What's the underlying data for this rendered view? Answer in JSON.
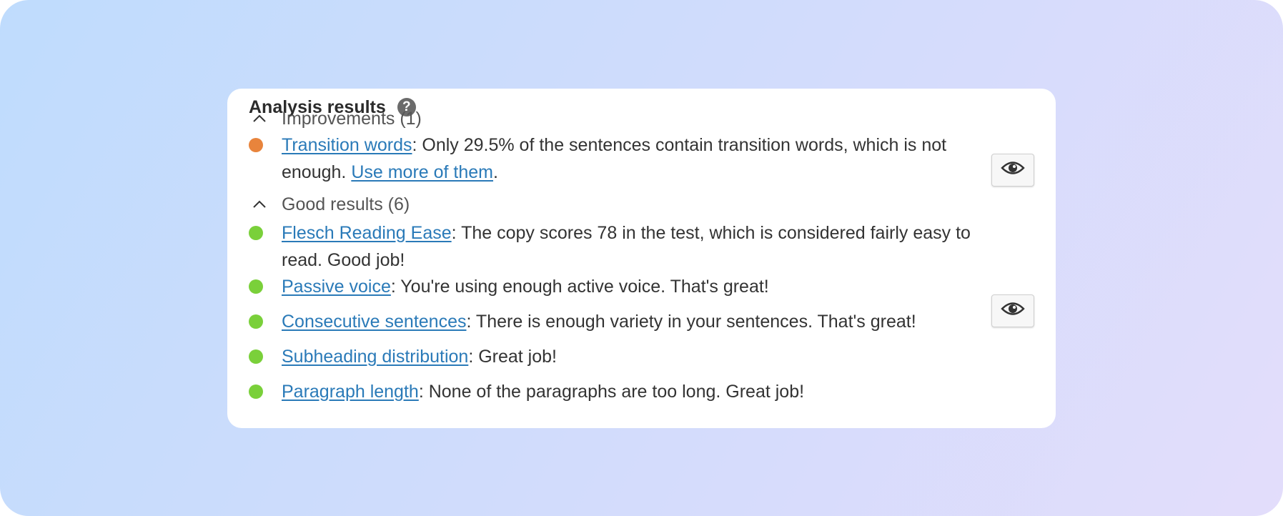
{
  "panel": {
    "title": "Analysis results",
    "help_icon_glyph": "?"
  },
  "colors": {
    "problem": "#e8843c",
    "good": "#7ad03a",
    "link": "#2a7ab8"
  },
  "groups": {
    "improvements": {
      "label": "Improvements (1)",
      "items": [
        {
          "link": "Transition words",
          "text": ": Only 29.5% of the sentences contain transition words, which is not enough. ",
          "link2": "Use more of them",
          "text2": ".",
          "status": "problem",
          "has_eye": true
        }
      ]
    },
    "good_results": {
      "label": "Good results (6)",
      "items": [
        {
          "link": "Flesch Reading Ease",
          "text": ": The copy scores 78 in the test, which is considered fairly easy to read. Good job!",
          "status": "good"
        },
        {
          "link": "Passive voice",
          "text": ": You're using enough active voice. That's great!",
          "status": "good",
          "has_eye": true
        },
        {
          "link": "Consecutive sentences",
          "text": ": There is enough variety in your sentences. That's great!",
          "status": "good"
        },
        {
          "link": "Subheading distribution",
          "text": ": Great job!",
          "status": "good"
        },
        {
          "link": "Paragraph length",
          "text": ": None of the paragraphs are too long. Great job!",
          "status": "good"
        }
      ]
    }
  }
}
